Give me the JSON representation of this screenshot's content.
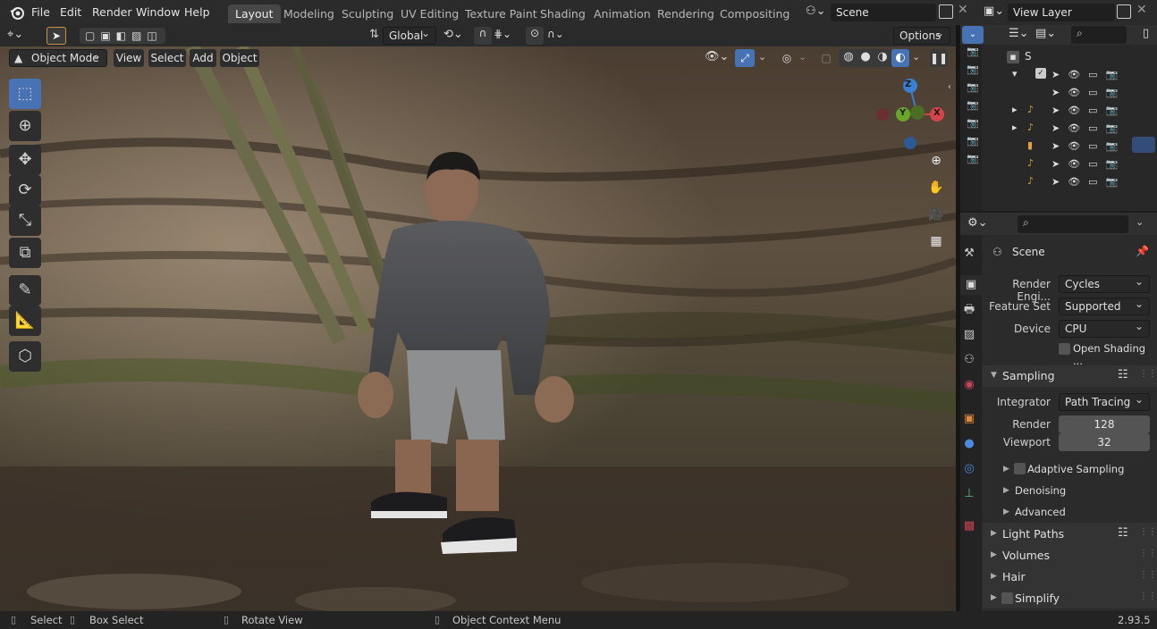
{
  "menu": {
    "file": "File",
    "edit": "Edit",
    "render": "Render",
    "window": "Window",
    "help": "Help"
  },
  "workspaces": [
    "Layout",
    "Modeling",
    "Sculpting",
    "UV Editing",
    "Texture Paint",
    "Shading",
    "Animation",
    "Rendering",
    "Compositing"
  ],
  "scene_field": "Scene",
  "view_layer_field": "View Layer",
  "toolbar": {
    "orientation": "Global",
    "options": "Options"
  },
  "viewport_header": {
    "mode": "Object Mode",
    "view": "View",
    "select": "Select",
    "add": "Add",
    "object": "Object"
  },
  "gizmo": {
    "z": "Z",
    "y": "Y",
    "x": "X"
  },
  "properties": {
    "context": "Scene",
    "render_engine_label": "Render Engi...",
    "render_engine": "Cycles",
    "feature_set_label": "Feature Set",
    "feature_set": "Supported",
    "device_label": "Device",
    "device": "CPU",
    "open_shading": "Open Shading ...",
    "sampling": "Sampling",
    "integrator_label": "Integrator",
    "integrator": "Path Tracing",
    "render_label": "Render",
    "render_value": "128",
    "viewport_label": "Viewport",
    "viewport_value": "32",
    "adaptive_sampling": "Adaptive Sampling",
    "denoising": "Denoising",
    "advanced": "Advanced",
    "light_paths": "Light Paths",
    "volumes": "Volumes",
    "hair": "Hair",
    "simplify": "Simplify"
  },
  "outliner": {
    "root_initial": "S"
  },
  "status": {
    "select": "Select",
    "box_select": "Box Select",
    "rotate_view": "Rotate View",
    "context_menu": "Object Context Menu",
    "version": "2.93.5"
  },
  "colors": {
    "active_blue": "#4772b3",
    "x_axis": "#d6444b",
    "y_axis": "#6aa52b",
    "z_axis": "#3a7fd1"
  }
}
